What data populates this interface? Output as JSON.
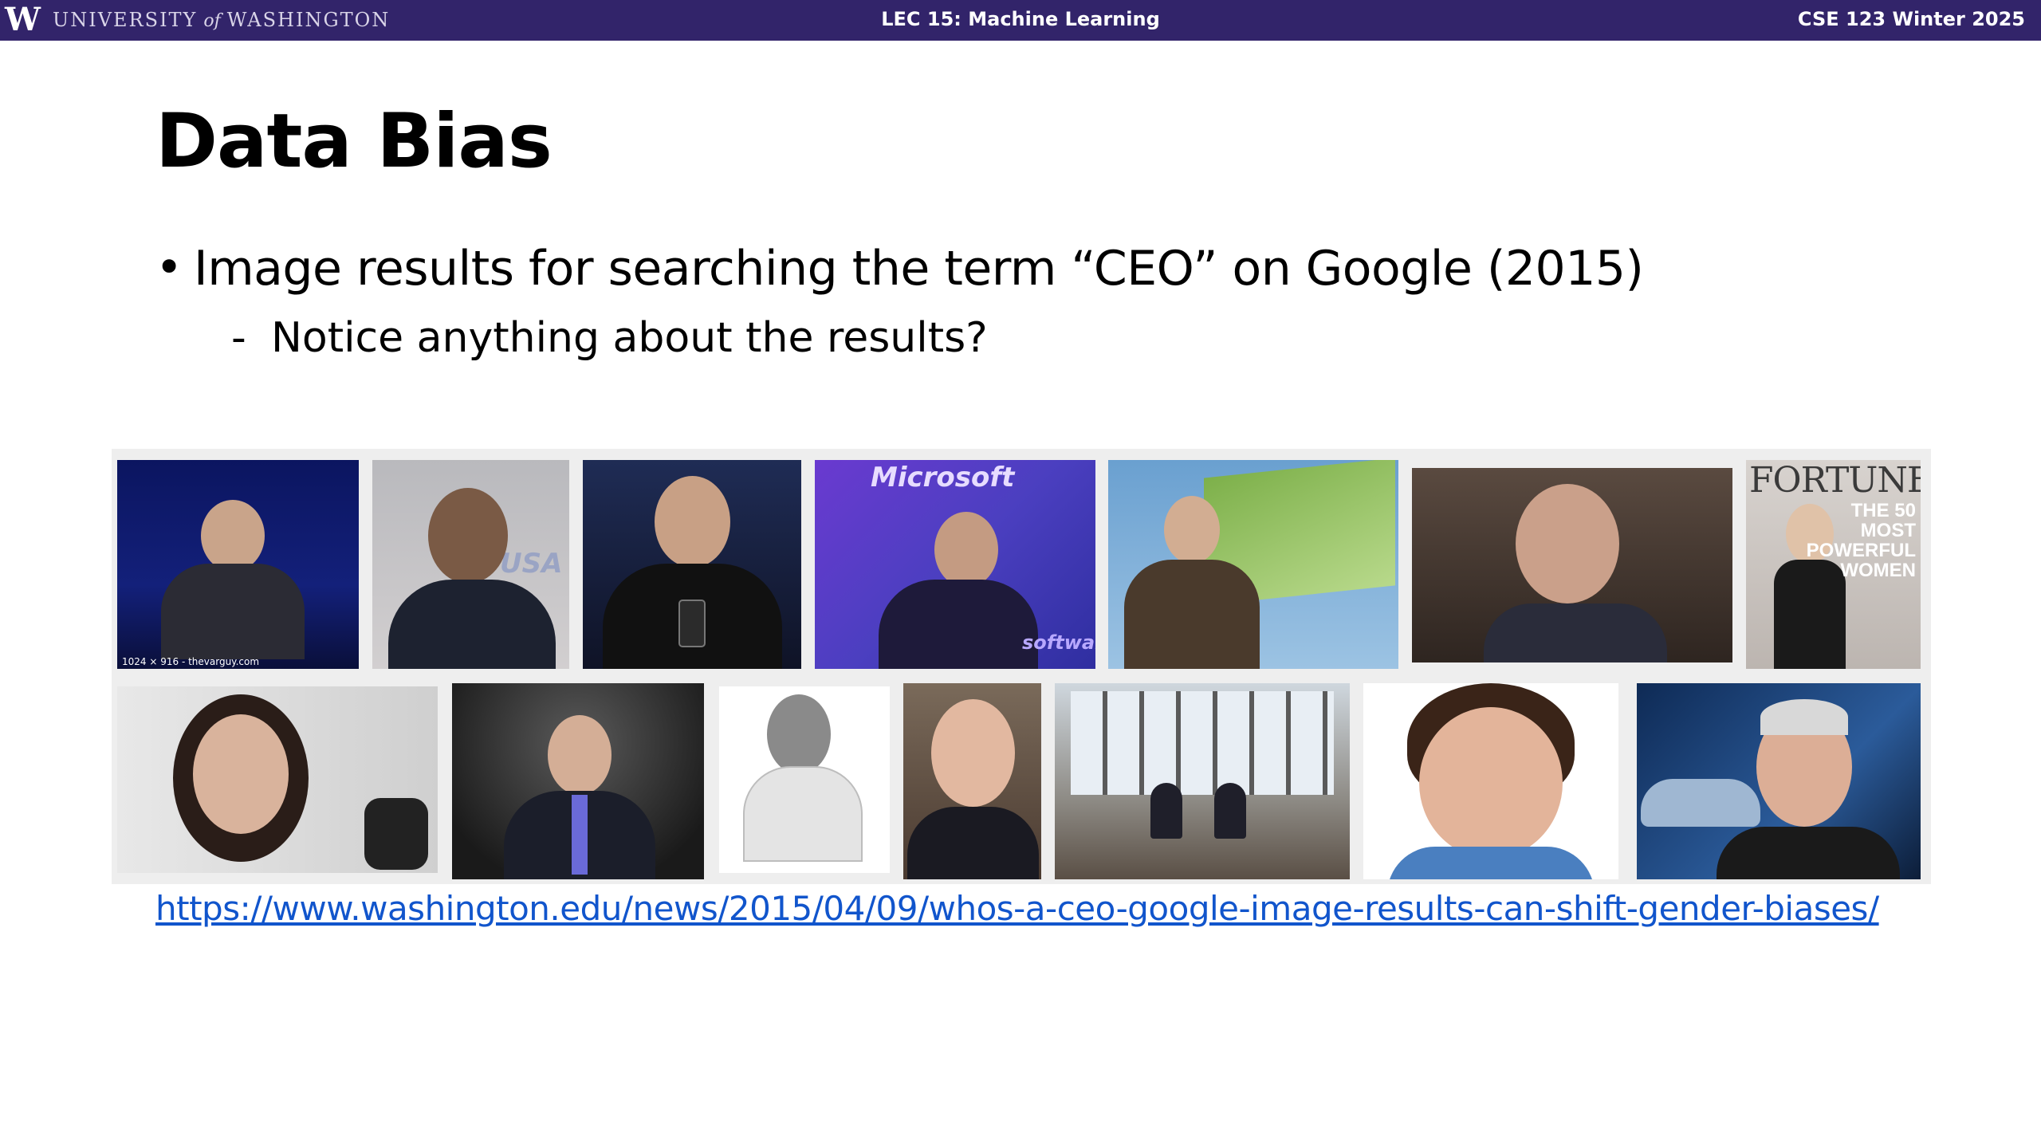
{
  "header": {
    "logo_letter": "W",
    "university_left": "UNIVERSITY",
    "university_of": "of",
    "university_right": "WASHINGTON",
    "lecture": "LEC 15: Machine Learning",
    "course": "CSE 123 Winter 2025"
  },
  "slide": {
    "title": "Data Bias",
    "bullet": "Image results for searching the term “CEO” on Google (2015)",
    "sub_bullet_marker": "-",
    "sub_bullet": "Notice anything about the results?",
    "link": "https://www.washington.edu/news/2015/04/09/whos-a-ceo-google-image-results-can-shift-gender-biases/"
  },
  "images": {
    "r1c1_caption": "1024 × 916 - thevarguy.com",
    "r1c2_text": "USA",
    "r1c4_text": "Microsoft",
    "r1c4_text2": "software",
    "r1c7_masthead": "FORTUNE",
    "r1c7_line1": "THE 50",
    "r1c7_line2": "MOST",
    "r1c7_line3": "POWERFUL",
    "r1c7_line4": "WOMEN"
  },
  "colors": {
    "header_bg": "#32246a",
    "link": "#1155cc"
  }
}
